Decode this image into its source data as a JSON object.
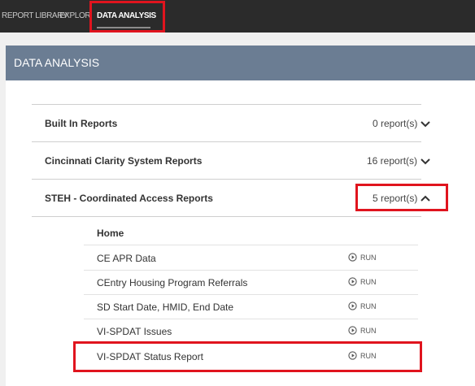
{
  "topnav": {
    "tabs": [
      {
        "label": "Report Library"
      },
      {
        "label": "Explori"
      },
      {
        "label": "Data Analysis",
        "active": true
      }
    ]
  },
  "panel": {
    "title": "Data Analysis",
    "sections": [
      {
        "title": "Built In Reports",
        "count": "0 report(s)",
        "expanded": false
      },
      {
        "title": "Cincinnati Clarity System Reports",
        "count": "16 report(s)",
        "expanded": false
      },
      {
        "title": "STEH - Coordinated Access Reports",
        "count": "5 report(s)",
        "expanded": true
      }
    ],
    "sub_header": "Home",
    "run_label": "RUN",
    "reports": [
      {
        "name": "CE APR Data"
      },
      {
        "name": "CEntry Housing Program Referrals"
      },
      {
        "name": "SD Start Date, HMID, End Date"
      },
      {
        "name": "VI-SPDAT Issues"
      },
      {
        "name": "VI-SPDAT Status Report"
      }
    ]
  },
  "colors": {
    "highlight": "#e0141e",
    "nav_bg": "#2b2b2b",
    "header_bg": "#6b7d93"
  }
}
